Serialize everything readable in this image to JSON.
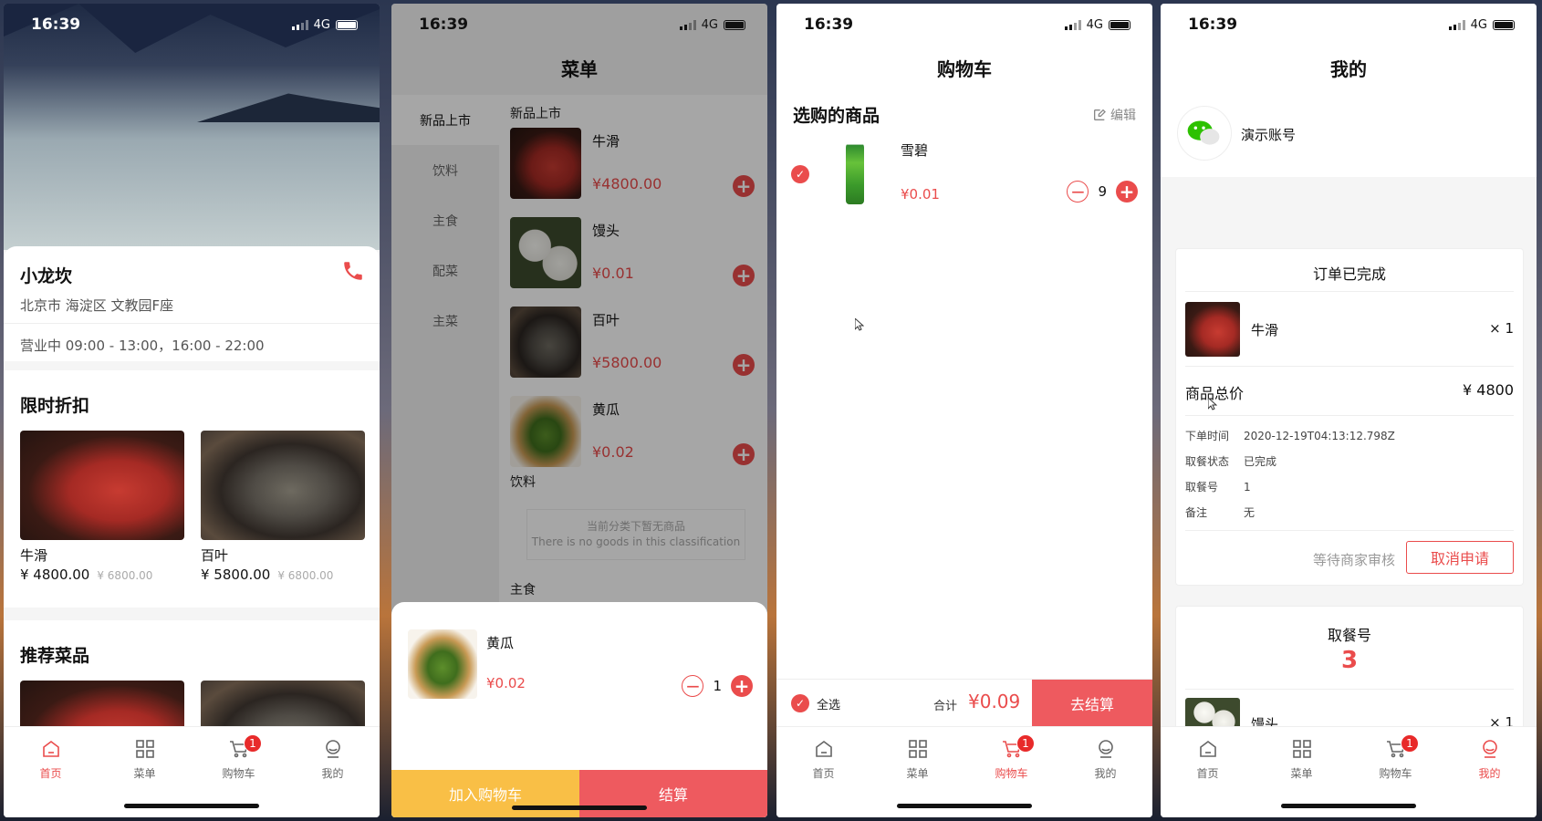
{
  "status": {
    "time": "16:39",
    "network": "4G"
  },
  "tabs": [
    "首页",
    "菜单",
    "购物车",
    "我的"
  ],
  "cart_badge": "1",
  "home": {
    "shop_name": "小龙坎",
    "address": "北京市 海淀区 文教园F座",
    "hours": "营业中 09:00 - 13:00，16:00 - 22:00",
    "discount_title": "限时折扣",
    "recommend_title": "推荐菜品",
    "products": [
      {
        "name": "牛滑",
        "price": "¥ 4800.00",
        "orig": "¥ 6800.00"
      },
      {
        "name": "百叶",
        "price": "¥ 5800.00",
        "orig": "¥ 6800.00"
      }
    ]
  },
  "menu": {
    "title": "菜单",
    "categories": [
      "新品上市",
      "饮料",
      "主食",
      "配菜",
      "主菜"
    ],
    "section_new": "新品上市",
    "section_drink": "饮料",
    "section_staple": "主食",
    "items": [
      {
        "name": "牛滑",
        "price": "¥4800.00"
      },
      {
        "name": "馒头",
        "price": "¥0.01"
      },
      {
        "name": "百叶",
        "price": "¥5800.00"
      },
      {
        "name": "黄瓜",
        "price": "¥0.02"
      }
    ],
    "empty_cn": "当前分类下暂无商品",
    "empty_en": "There is no goods in this classification",
    "sheet": {
      "name": "黄瓜",
      "price": "¥0.02",
      "qty": "1",
      "add_cart": "加入购物车",
      "checkout": "结算"
    }
  },
  "cart": {
    "title": "购物车",
    "header": "选购的商品",
    "edit": "编辑",
    "item": {
      "name": "雪碧",
      "price": "¥0.01",
      "qty": "9"
    },
    "select_all": "全选",
    "total_label": "合计",
    "total_value": "¥0.09",
    "checkout": "去结算"
  },
  "mine": {
    "title": "我的",
    "username": "演示账号",
    "order_status": "订单已完成",
    "order_item": {
      "name": "牛滑",
      "qty": "× 1"
    },
    "total_label": "商品总价",
    "total_value": "¥ 4800",
    "details": [
      {
        "k": "下单时间",
        "v": "2020-12-19T04:13:12.798Z"
      },
      {
        "k": "取餐状态",
        "v": "已完成"
      },
      {
        "k": "取餐号",
        "v": "1"
      },
      {
        "k": "备注",
        "v": "无"
      }
    ],
    "waiting": "等待商家审核",
    "cancel": "取消申请",
    "pickup_label": "取餐号",
    "pickup_number": "3",
    "next_item": {
      "name": "馒头",
      "qty": "× 1"
    }
  },
  "colors": {
    "accent": "#ea4c4c",
    "yellow": "#f9bf46"
  }
}
